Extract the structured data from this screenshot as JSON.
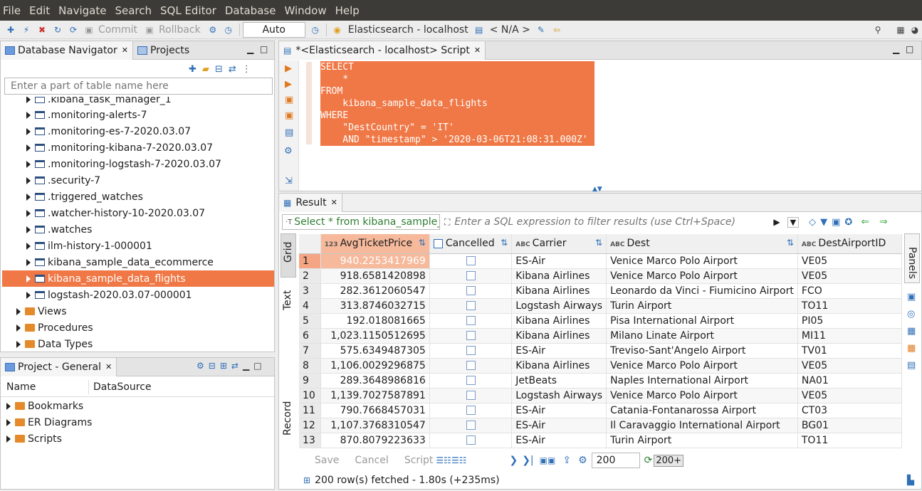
{
  "menu": [
    "File",
    "Edit",
    "Navigate",
    "Search",
    "SQL Editor",
    "Database",
    "Window",
    "Help"
  ],
  "toolbar": {
    "commit": "Commit",
    "rollback": "Rollback",
    "transaction_mode": "Auto",
    "datasource": "Elasticsearch - localhost",
    "schema": "< N/A >"
  },
  "navigator": {
    "tab_label": "Database Navigator",
    "projects_tab": "Projects",
    "filter_placeholder": "Enter a part of table name here",
    "items": [
      ".kibana_task_manager_1",
      ".monitoring-alerts-7",
      ".monitoring-es-7-2020.03.07",
      ".monitoring-kibana-7-2020.03.07",
      ".monitoring-logstash-7-2020.03.07",
      ".security-7",
      ".triggered_watches",
      ".watcher-history-10-2020.03.07",
      ".watches",
      "ilm-history-1-000001",
      "kibana_sample_data_ecommerce",
      "kibana_sample_data_flights",
      "logstash-2020.03.07-000001"
    ],
    "folders": [
      "Views",
      "Procedures",
      "Data Types"
    ]
  },
  "project": {
    "tab_label": "Project - General",
    "col_name": "Name",
    "col_datasource": "DataSource",
    "items": [
      "Bookmarks",
      "ER Diagrams",
      "Scripts"
    ]
  },
  "editor": {
    "tab_label": "*<Elasticsearch - localhost> Script",
    "code": [
      "SELECT",
      "    *",
      "FROM",
      "    kibana_sample_data_flights",
      "WHERE",
      "    \"DestCountry\" = 'IT'",
      "    AND \"timestamp\" > '2020-03-06T21:08:31.000Z'"
    ]
  },
  "result": {
    "tab_label": "Result",
    "query_label": "Select * from kibana_sample_",
    "filter_placeholder": "Enter a SQL expression to filter results (use Ctrl+Space)",
    "side_tabs": [
      "Grid",
      "Text",
      "Record"
    ],
    "panels_label": "Panels",
    "columns": [
      {
        "type": "123",
        "name": "AvgTicketPrice"
      },
      {
        "type": "chk",
        "name": "Cancelled"
      },
      {
        "type": "ABC",
        "name": "Carrier"
      },
      {
        "type": "ABC",
        "name": "Dest"
      },
      {
        "type": "ABC",
        "name": "DestAirportID"
      }
    ],
    "rows": [
      [
        "1",
        "940.2253417969",
        "Kibana Airlines",
        "Venice Marco Polo Airport",
        "VE05"
      ],
      [
        "2",
        "918.6581420898",
        "Kibana Airlines",
        "Venice Marco Polo Airport",
        "VE05"
      ],
      [
        "3",
        "282.3612060547",
        "Kibana Airlines",
        "Leonardo da Vinci - Fiumicino Airport",
        "FCO"
      ],
      [
        "4",
        "313.8746032715",
        "Logstash Airways",
        "Turin Airport",
        "TO11"
      ],
      [
        "5",
        "192.018081665",
        "Kibana Airlines",
        "Pisa International Airport",
        "PI05"
      ],
      [
        "6",
        "1,023.1150512695",
        "Kibana Airlines",
        "Milano Linate Airport",
        "MI11"
      ],
      [
        "7",
        "575.6349487305",
        "ES-Air",
        "Treviso-Sant'Angelo Airport",
        "TV01"
      ],
      [
        "8",
        "1,106.0029296875",
        "Kibana Airlines",
        "Venice Marco Polo Airport",
        "VE05"
      ],
      [
        "9",
        "289.3648986816",
        "JetBeats",
        "Naples International Airport",
        "NA01"
      ],
      [
        "10",
        "1,139.7027587891",
        "Logstash Airways",
        "Venice Marco Polo Airport",
        "VE05"
      ],
      [
        "11",
        "790.7668457031",
        "ES-Air",
        "Catania-Fontanarossa Airport",
        "CT03"
      ],
      [
        "12",
        "1,107.3768310547",
        "ES-Air",
        "Il Caravaggio International Airport",
        "BG01"
      ],
      [
        "13",
        "870.8079223633",
        "ES-Air",
        "Turin Airport",
        "TO11"
      ]
    ],
    "first_row_carrier": "ES-Air",
    "save": "Save",
    "cancel": "Cancel",
    "script": "Script",
    "fetch_size": "200",
    "fetch_more": "200+",
    "status": "200 row(s) fetched - 1.80s (+235ms)"
  },
  "colors": {
    "accent": "#f07846",
    "menubar": "#3c3b37"
  }
}
